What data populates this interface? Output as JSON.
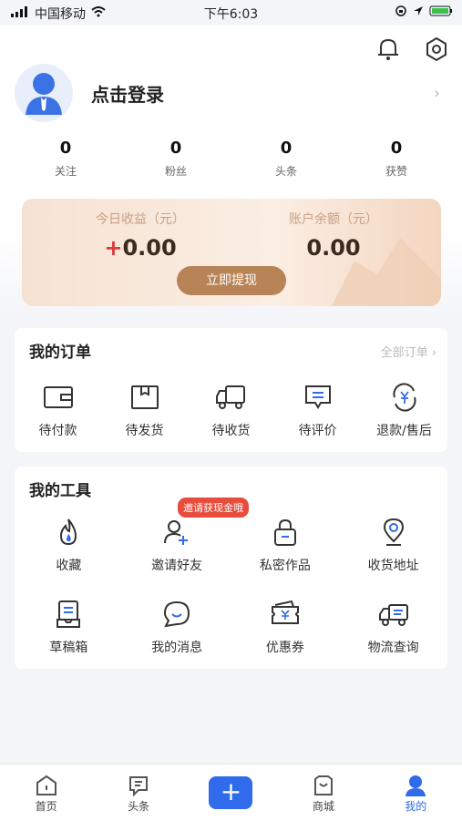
{
  "status": {
    "carrier": "中国移动",
    "time": "下午6:03"
  },
  "profile": {
    "login_text": "点击登录"
  },
  "stats": [
    {
      "value": "0",
      "label": "关注"
    },
    {
      "value": "0",
      "label": "粉丝"
    },
    {
      "value": "0",
      "label": "头条"
    },
    {
      "value": "0",
      "label": "获赞"
    }
  ],
  "earnings": {
    "today_label": "今日收益（元）",
    "today_plus": "+",
    "today_value": "0.00",
    "balance_label": "账户余额（元）",
    "balance_value": "0.00",
    "withdraw_label": "立即提现"
  },
  "orders": {
    "title": "我的订单",
    "all_label": "全部订单 ›",
    "items": [
      {
        "label": "待付款",
        "icon": "wallet-icon"
      },
      {
        "label": "待发货",
        "icon": "box-icon"
      },
      {
        "label": "待收货",
        "icon": "truck-icon"
      },
      {
        "label": "待评价",
        "icon": "comment-icon"
      },
      {
        "label": "退款/售后",
        "icon": "refund-icon"
      }
    ]
  },
  "tools": {
    "title": "我的工具",
    "badge": "邀请获现金哦",
    "items": [
      {
        "label": "收藏",
        "icon": "flame-icon"
      },
      {
        "label": "邀请好友",
        "icon": "add-user-icon"
      },
      {
        "label": "私密作品",
        "icon": "lock-icon"
      },
      {
        "label": "收货地址",
        "icon": "location-icon"
      },
      {
        "label": "草稿箱",
        "icon": "draft-icon"
      },
      {
        "label": "我的消息",
        "icon": "message-icon"
      },
      {
        "label": "优惠券",
        "icon": "coupon-icon"
      },
      {
        "label": "物流查询",
        "icon": "delivery-icon"
      }
    ]
  },
  "tabbar": [
    {
      "label": "首页",
      "icon": "home-icon"
    },
    {
      "label": "头条",
      "icon": "headline-icon"
    },
    {
      "label": "",
      "icon": "plus-icon"
    },
    {
      "label": "商城",
      "icon": "shop-icon"
    },
    {
      "label": "我的",
      "icon": "profile-icon"
    }
  ],
  "colors": {
    "accent": "#2f6bea",
    "withdraw": "#b88356",
    "badge": "#e74c3c"
  }
}
